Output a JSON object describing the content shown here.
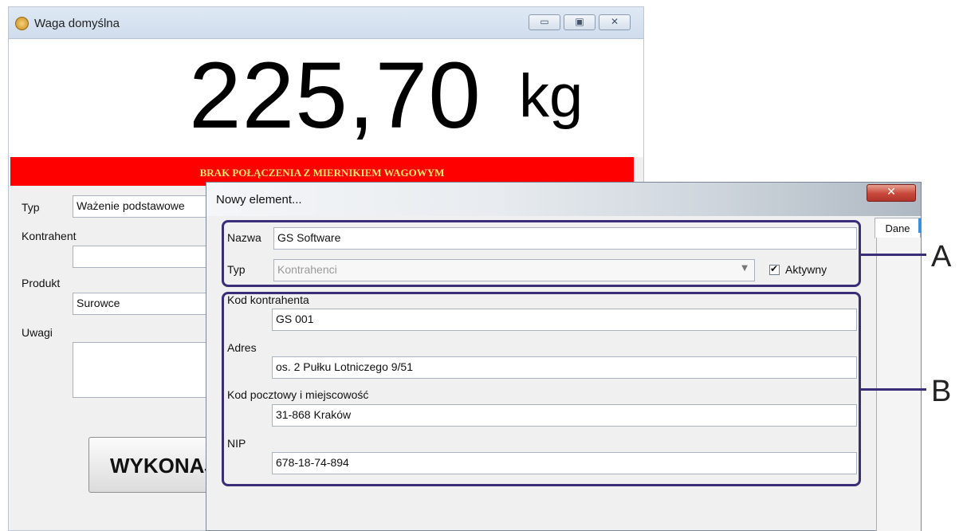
{
  "scale_window": {
    "title": "Waga domyślna",
    "controls": {
      "minimize": "▭",
      "maximize": "▣",
      "close": "✕"
    },
    "weight_value": "225,70",
    "weight_unit": "kg",
    "status_banner": "BRAK POŁĄCZENIA Z MIERNIKIEM WAGOWYM",
    "form": {
      "typ_label": "Typ",
      "typ_value": "Ważenie podstawowe",
      "kontrahent_label": "Kontrahent",
      "kontrahent_value": "",
      "produkt_label": "Produkt",
      "produkt_value": "Surowce",
      "uwagi_label": "Uwagi",
      "uwagi_value": ""
    },
    "action_button": "WYKONAJ"
  },
  "dialog": {
    "title": "Nowy element...",
    "close_glyph": "✕",
    "tab_label": "Dane",
    "section_a": {
      "nazwa_label": "Nazwa",
      "nazwa_value": "GS Software",
      "typ_label": "Typ",
      "typ_value": "Kontrahenci",
      "aktywny_label": "Aktywny",
      "aktywny_checked": true
    },
    "section_b": {
      "kod_label": "Kod kontrahenta",
      "kod_value": "GS 001",
      "adres_label": "Adres",
      "adres_value": "os. 2 Pułku Lotniczego 9/51",
      "kod_pocztowy_label": "Kod pocztowy i miejscowość",
      "kod_pocztowy_value": "31-868 Kraków",
      "nip_label": "NIP",
      "nip_value": "678-18-74-894"
    }
  },
  "callouts": {
    "a": "A",
    "b": "B"
  },
  "colors": {
    "alarm_bg": "#ff0000",
    "alarm_text": "#ffe86a",
    "callout": "#3b2e78"
  }
}
